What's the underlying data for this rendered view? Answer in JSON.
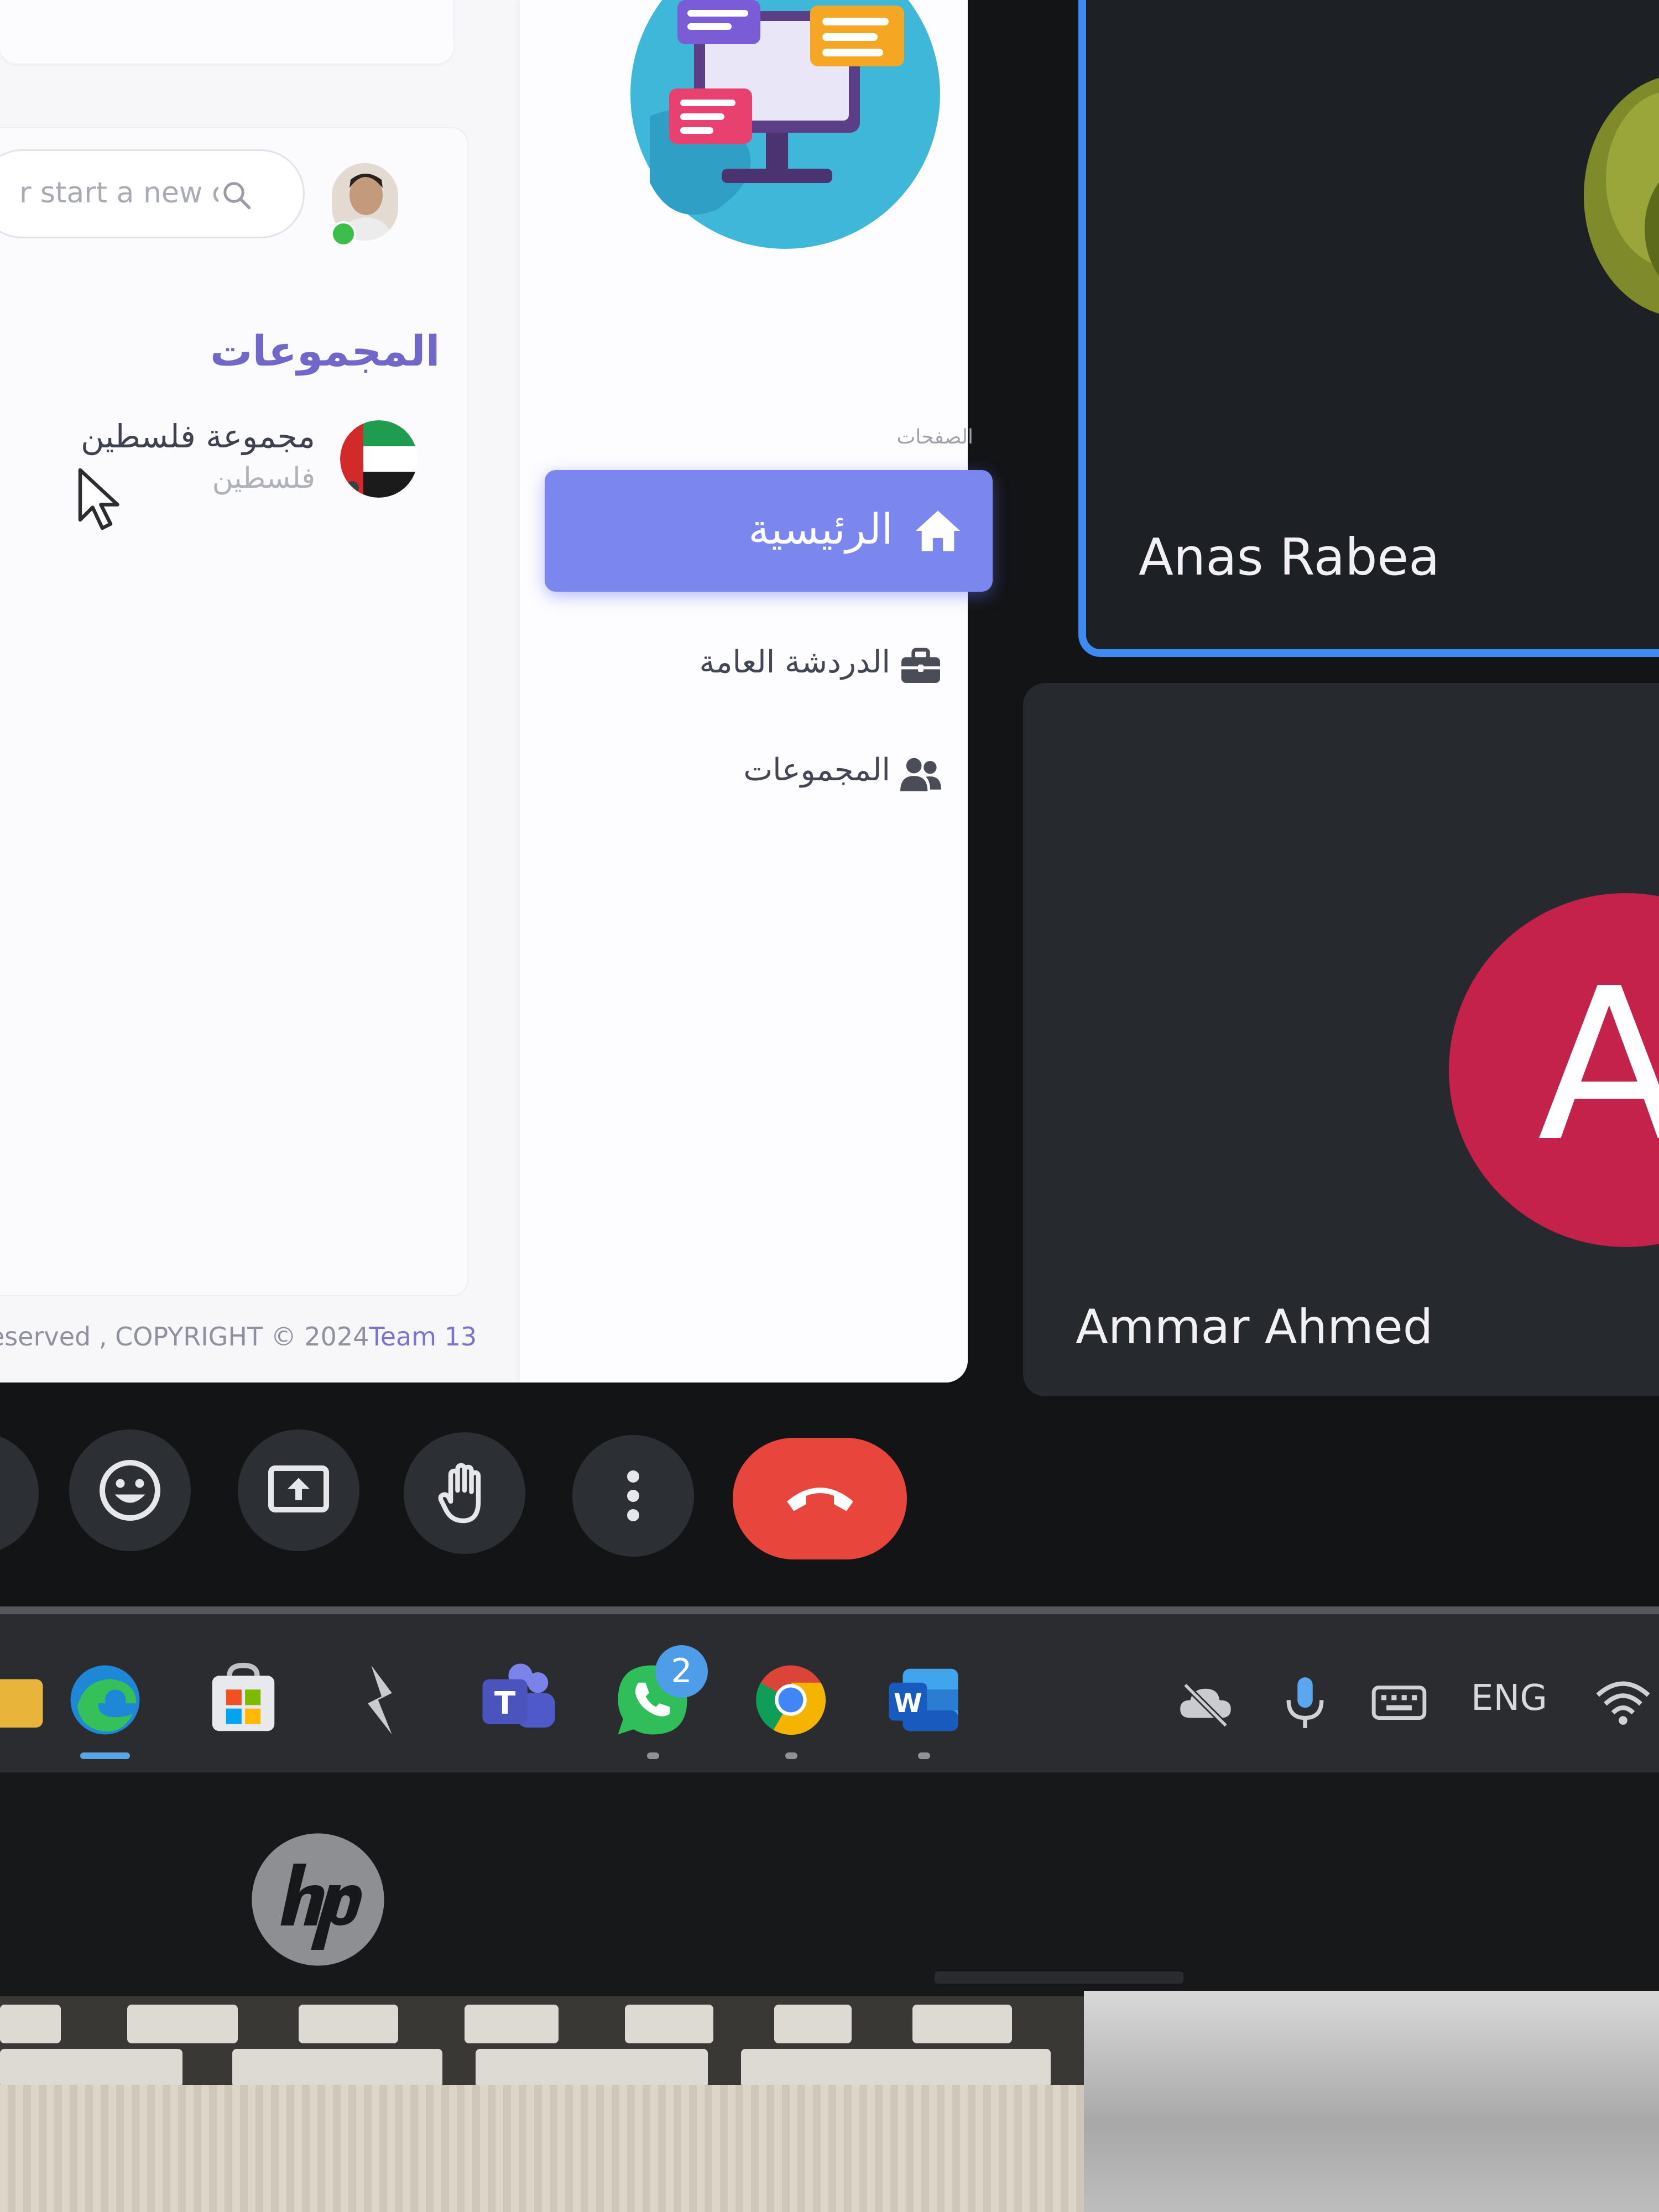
{
  "shared_screen": {
    "search": {
      "placeholder": "r start a new chat"
    },
    "groups_heading": "المجموعات",
    "group_item": {
      "name": "مجموعة فلسطين",
      "subtitle": "فلسطين"
    },
    "copyright": {
      "text": "eserved , COPYRIGHT © 2024",
      "brand": "Team 13"
    },
    "sidebar": {
      "pages_label": "الصفحات",
      "nav": [
        {
          "label": "الرئيسية",
          "icon": "home-icon",
          "active": true
        },
        {
          "label": "الدردشة العامة",
          "icon": "briefcase-icon",
          "active": false
        },
        {
          "label": "المجموعات",
          "icon": "users-icon",
          "active": false
        }
      ]
    },
    "colors": {
      "accent": "#7b86ef",
      "heading": "#7167c9"
    }
  },
  "participants": [
    {
      "name": "Anas Rabea",
      "speaking": true,
      "border_color": "#3d8bf2"
    },
    {
      "name": "Ammar Ahmed",
      "initial": "A",
      "avatar_color": "#c4224a"
    }
  ],
  "controls": [
    {
      "icon": "emoji-icon"
    },
    {
      "icon": "present-screen-icon"
    },
    {
      "icon": "raise-hand-icon"
    },
    {
      "icon": "more-options-icon"
    },
    {
      "icon": "leave-call-icon",
      "color": "#e8453c"
    }
  ],
  "taskbar": {
    "apps": [
      "edge-icon",
      "store-icon",
      "bolt-app-icon",
      "teams-icon",
      "whatsapp-icon",
      "chrome-icon",
      "word-icon"
    ],
    "whatsapp_badge": "2",
    "tray": {
      "language": "ENG"
    }
  },
  "device": {
    "brand": "hp"
  }
}
